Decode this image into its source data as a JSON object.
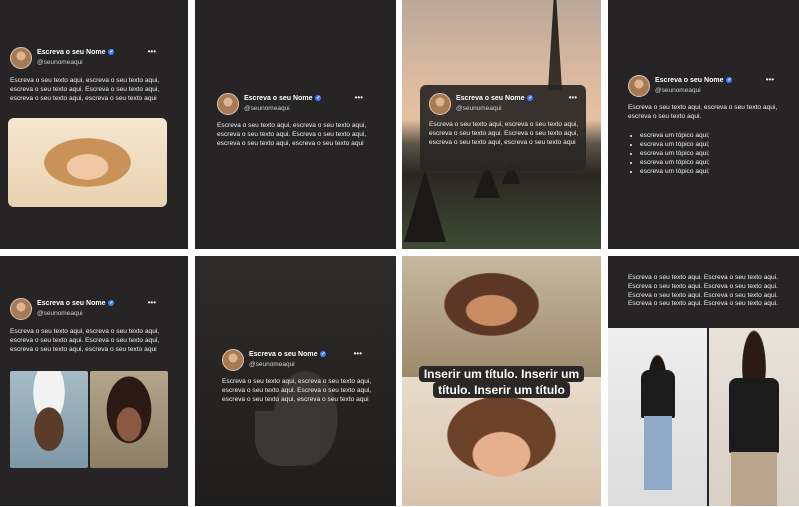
{
  "profile": {
    "name": "Escreva o seu Nome",
    "handle": "@seunomeaqui",
    "more": "•••",
    "verified_color": "#3b82f6"
  },
  "cards": {
    "c1": {
      "text": "Escreva o seu texto aqui, escreva o seu texto aqui, escreva o seu texto aqui. Escreva o seu texto aqui, escreva o seu texto aqui, escreva o seu texto aqui"
    },
    "c2": {
      "text": "Escreva o seu texto aqui, escreva o seu texto aqui, escreva o seu texto aqui. Escreva o seu texto aqui, escreva o seu texto aqui, escreva o seu texto aqui"
    },
    "c3": {
      "text": "Escreva o seu texto aqui, escreva o seu texto aqui, escreva o seu texto aqui. Escreva o seu texto aqui, escreva o seu texto aqui, escreva o seu texto aqui"
    },
    "c4": {
      "text": "Escreva o seu texto aqui, escreva o seu texto aqui, escreva o seu texto aqui.",
      "bullets": [
        "escreva um tópico aqui;",
        "escreva um tópico aqui;",
        "escreva um tópico aqui;",
        "escreva um tópico aqui;",
        "escreva um tópico aqui;"
      ]
    },
    "c5": {
      "text": "Escreva o seu texto aqui, escreva o seu texto aqui, escreva o seu texto aqui. Escreva o seu texto aqui, escreva o seu texto aqui, escreva o seu texto aqui"
    },
    "c6": {
      "text": "Escreva o seu texto aqui, escreva o seu texto aqui, escreva o seu texto aqui. Escreva o seu texto aqui, escreva o seu texto aqui, escreva o seu texto aqui"
    },
    "c7": {
      "title_line1": "Inserir um título. Inserir um",
      "title_line2": "título. Inserir um título"
    },
    "c8": {
      "text": "Escreva o seu texto aqui. Escreva o seu texto aqui. Escreva o seu texto aqui. Escreva o seu texto aqui. Escreva o seu texto aqui. Escreva o seu texto aqui. Escreva o seu texto aqui. Escreva o seu texto aqui."
    }
  },
  "colors": {
    "card_bg": "#262424",
    "text": "#f2f2f2",
    "accent": "#3b82f6"
  }
}
